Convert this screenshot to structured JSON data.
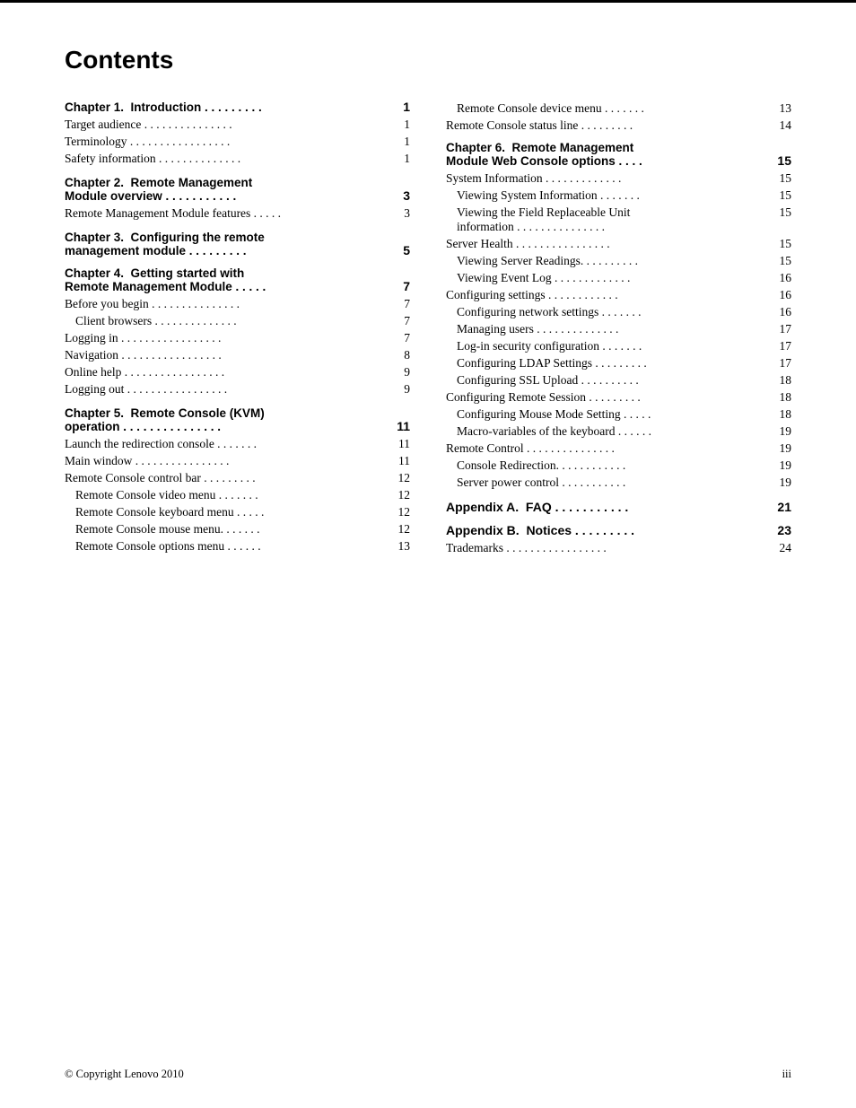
{
  "page": {
    "title": "Contents",
    "footer_copyright": "© Copyright Lenovo 2010",
    "footer_page": "iii"
  },
  "left_col": {
    "chapters": [
      {
        "id": "ch1",
        "heading": "Chapter 1.  Introduction . . . . . . . . .",
        "page": "1",
        "entries": [
          {
            "indent": 0,
            "label": "Target audience . . . . . . . . . . . . . . .",
            "page": "1"
          },
          {
            "indent": 0,
            "label": "Terminology . . . . . . . . . . . . . . . . .",
            "page": "1"
          },
          {
            "indent": 0,
            "label": "Safety information . . . . . . . . . . . . . .",
            "page": "1"
          }
        ]
      },
      {
        "id": "ch2",
        "heading": "Chapter 2.  Remote Management\nModule overview . . . . . . . . . . .",
        "page": "3",
        "entries": [
          {
            "indent": 0,
            "label": "Remote Management Module features . . . . .",
            "page": "3"
          }
        ]
      },
      {
        "id": "ch3",
        "heading": "Chapter 3.  Configuring the remote\nmanagement module . . . . . . . . .",
        "page": "5",
        "entries": []
      },
      {
        "id": "ch4",
        "heading": "Chapter 4.  Getting started with\nRemote Management Module . . . . .",
        "page": "7",
        "entries": [
          {
            "indent": 0,
            "label": "Before you begin . . . . . . . . . . . . . . .",
            "page": "7"
          },
          {
            "indent": 1,
            "label": "Client browsers . . . . . . . . . . . . . .",
            "page": "7"
          },
          {
            "indent": 0,
            "label": "Logging in  . . . . . . . . . . . . . . . . .",
            "page": "7"
          },
          {
            "indent": 0,
            "label": "Navigation  . . . . . . . . . . . . . . . . .",
            "page": "8"
          },
          {
            "indent": 0,
            "label": "Online help . . . . . . . . . . . . . . . . .",
            "page": "9"
          },
          {
            "indent": 0,
            "label": "Logging out . . . . . . . . . . . . . . . . .",
            "page": "9"
          }
        ]
      },
      {
        "id": "ch5",
        "heading": "Chapter 5.  Remote Console (KVM)\noperation  . . . . . . . . . . . . . . .",
        "page": "11",
        "entries": [
          {
            "indent": 0,
            "label": "Launch the redirection console  . . . . . . .",
            "page": "11"
          },
          {
            "indent": 0,
            "label": "Main window  . . . . . . . . . . . . . . . .",
            "page": "11"
          },
          {
            "indent": 0,
            "label": "Remote Console control bar  . . . . . . . . .",
            "page": "12"
          },
          {
            "indent": 1,
            "label": "Remote Console video menu . . . . . . .",
            "page": "12"
          },
          {
            "indent": 1,
            "label": "Remote Console keyboard menu  . . . . .",
            "page": "12"
          },
          {
            "indent": 1,
            "label": "Remote Console mouse menu.  . . . . . .",
            "page": "12"
          },
          {
            "indent": 1,
            "label": "Remote Console options menu  . . . . . .",
            "page": "13"
          }
        ]
      }
    ]
  },
  "right_col": {
    "entries_top": [
      {
        "indent": 1,
        "label": "Remote Console device menu .  . . . . . .",
        "page": "13"
      },
      {
        "indent": 0,
        "label": "Remote Console status line   . . . . . . . . .",
        "page": "14"
      }
    ],
    "chapters": [
      {
        "id": "ch6",
        "heading": "Chapter 6.  Remote Management\nModule Web Console options  . . . .",
        "page": "15",
        "entries": [
          {
            "indent": 0,
            "label": "System Information . . . . . . . . . . . . .",
            "page": "15"
          },
          {
            "indent": 1,
            "label": "Viewing System Information  . . . . . . .",
            "page": "15"
          },
          {
            "indent": 1,
            "label": "Viewing the Field Replaceable Unit\ninformation  . . . . . . . . . . . . . . .",
            "page": "15"
          },
          {
            "indent": 0,
            "label": "Server Health  . . . . . . . . . . . . . . . .",
            "page": "15"
          },
          {
            "indent": 1,
            "label": "Viewing Server Readings. . . . . . . . . .",
            "page": "15"
          },
          {
            "indent": 1,
            "label": "Viewing Event Log . . . . . . . . . . . . .",
            "page": "16"
          },
          {
            "indent": 0,
            "label": "Configuring settings  . . . . . . . . . . . .",
            "page": "16"
          },
          {
            "indent": 1,
            "label": "Configuring network settings  . . . . . . .",
            "page": "16"
          },
          {
            "indent": 1,
            "label": "Managing users  . . . . . . . . . . . . . .",
            "page": "17"
          },
          {
            "indent": 1,
            "label": "Log-in security configuration  . . . . . . .",
            "page": "17"
          },
          {
            "indent": 1,
            "label": "Configuring LDAP Settings . . . . . . . . .",
            "page": "17"
          },
          {
            "indent": 1,
            "label": "Configuring SSL Upload  . . . . . . . . . .",
            "page": "18"
          },
          {
            "indent": 0,
            "label": "Configuring Remote Session  . . . . . . . . .",
            "page": "18"
          },
          {
            "indent": 1,
            "label": "Configuring Mouse Mode Setting  . . . . .",
            "page": "18"
          },
          {
            "indent": 1,
            "label": "Macro-variables of the keyboard . . . . . .",
            "page": "19"
          },
          {
            "indent": 0,
            "label": "Remote Control  . . . . . . . . . . . . . . .",
            "page": "19"
          },
          {
            "indent": 1,
            "label": "Console Redirection.  . . . . . . . . . . .",
            "page": "19"
          },
          {
            "indent": 1,
            "label": "Server power control  . . . . . . . . . . .",
            "page": "19"
          }
        ]
      },
      {
        "id": "appA",
        "heading": "Appendix A.  FAQ . . . . . . . . . . .",
        "page": "21",
        "entries": []
      },
      {
        "id": "appB",
        "heading": "Appendix B.  Notices  . . . . . . . . .",
        "page": "23",
        "entries": [
          {
            "indent": 0,
            "label": "Trademarks . . . . . . . . . . . . . . . . .",
            "page": "24"
          }
        ]
      }
    ]
  }
}
